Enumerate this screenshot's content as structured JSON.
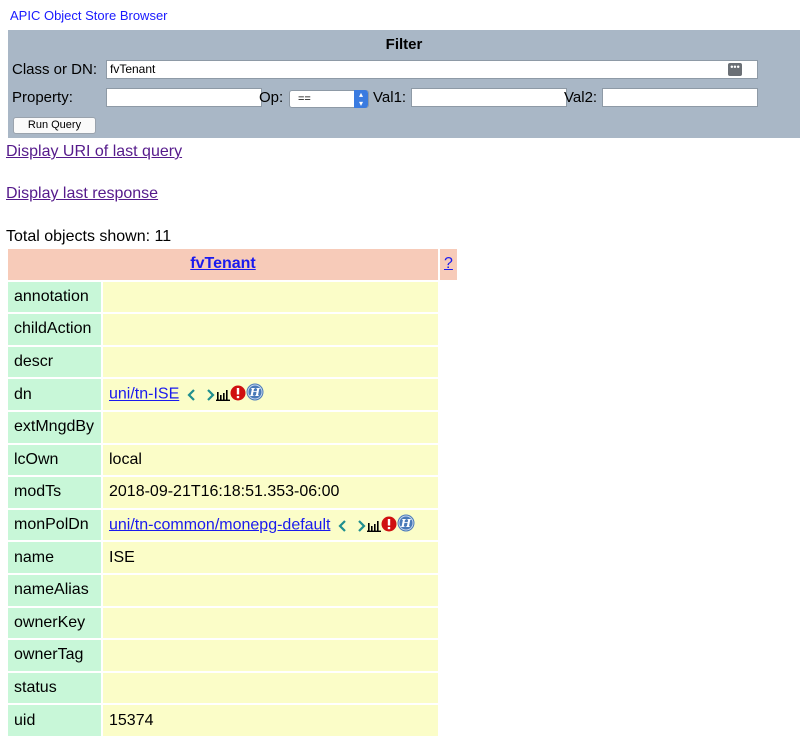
{
  "app_title": "APIC Object Store Browser",
  "filter": {
    "title": "Filter",
    "class_label": "Class or DN:",
    "class_value": "fvTenant",
    "property_label": "Property:",
    "property_value": "",
    "op_label": "Op:",
    "op_value": "==",
    "val1_label": "Val1:",
    "val1_value": "",
    "val2_label": "Val2:",
    "val2_value": "",
    "run_button": "Run Query"
  },
  "links": {
    "uri": "Display URI of last query",
    "response": "Display last response"
  },
  "total": "Total objects shown: 11",
  "table": {
    "class_name": "fvTenant",
    "help": "?",
    "rows": [
      {
        "prop": "annotation",
        "value": ""
      },
      {
        "prop": "childAction",
        "value": ""
      },
      {
        "prop": "descr",
        "value": ""
      },
      {
        "prop": "dn",
        "value": "uni/tn-ISE",
        "link": true
      },
      {
        "prop": "extMngdBy",
        "value": ""
      },
      {
        "prop": "lcOwn",
        "value": "local"
      },
      {
        "prop": "modTs",
        "value": "2018-09-21T16:18:51.353-06:00"
      },
      {
        "prop": "monPolDn",
        "value": "uni/tn-common/monepg-default",
        "link": true
      },
      {
        "prop": "name",
        "value": "ISE"
      },
      {
        "prop": "nameAlias",
        "value": ""
      },
      {
        "prop": "ownerKey",
        "value": ""
      },
      {
        "prop": "ownerTag",
        "value": ""
      },
      {
        "prop": "status",
        "value": ""
      },
      {
        "prop": "uid",
        "value": "15374"
      }
    ]
  },
  "colors": {
    "filter_bg": "#a9b7c6",
    "header_bg": "#f7cbb9",
    "prop_bg": "#c8f7d8",
    "value_bg": "#fbfdc8",
    "link": "#1a1aee"
  },
  "link_icons": [
    "chevron-left-icon",
    "chevron-right-icon",
    "stats-bars-icon",
    "fault-alert-icon",
    "history-icon"
  ]
}
